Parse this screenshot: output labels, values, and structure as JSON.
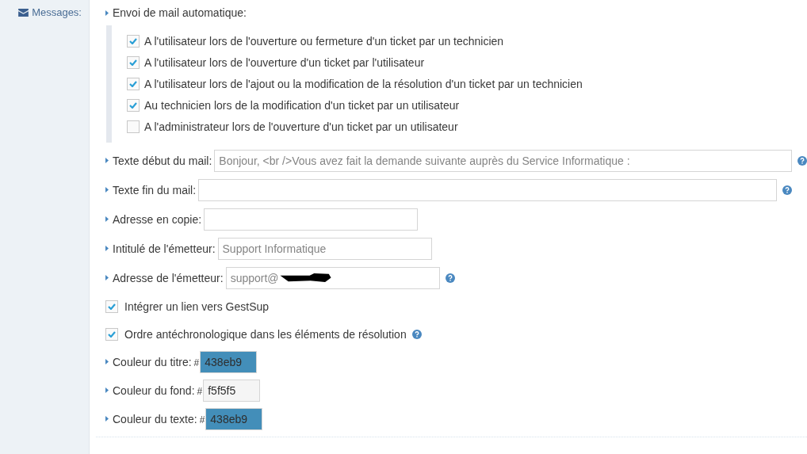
{
  "sidebar": {
    "label": "Messages:"
  },
  "auto_mail": {
    "title": "Envoi de mail automatique:",
    "options": [
      {
        "label": "A l'utilisateur lors de l'ouverture ou fermeture d'un ticket par un technicien",
        "checked": true
      },
      {
        "label": "A l'utilisateur lors de l'ouverture d'un ticket par l'utilisateur",
        "checked": true
      },
      {
        "label": "A l'utilisateur lors de l'ajout ou la modification de la résolution d'un ticket par un technicien",
        "checked": true
      },
      {
        "label": "Au technicien lors de la modification d'un ticket par un utilisateur",
        "checked": true
      },
      {
        "label": "A l'administrateur lors de l'ouverture d'un ticket par un utilisateur",
        "checked": false
      }
    ]
  },
  "settings": [
    {
      "kind": "long_text",
      "label": "Texte début du mail:",
      "value": "Bonjour, <br />Vous avez fait la demande suivante auprès du Service Informatique :",
      "help": true
    },
    {
      "kind": "long_text",
      "label": "Texte fin du mail:",
      "help": true
    },
    {
      "kind": "text",
      "label": "Adresse en copie:",
      "help": false
    },
    {
      "kind": "text",
      "label": "Intitulé de l'émetteur:",
      "value": "Support Informatique",
      "help": false
    },
    {
      "kind": "text",
      "label": "Adresse de l'émetteur:",
      "value": "support@",
      "redacted": true,
      "help": true
    },
    {
      "kind": "check",
      "label": "Intégrer un lien vers GestSup",
      "checked": true,
      "help": false
    },
    {
      "kind": "check",
      "label": "Ordre antéchronologique dans les éléments de résolution",
      "checked": true,
      "help": true
    },
    {
      "kind": "color",
      "label": "Couleur du titre:",
      "hash": "#",
      "value": "438eb9"
    },
    {
      "kind": "color",
      "label": "Couleur du fond:",
      "hash": "#",
      "value": "f5f5f5"
    },
    {
      "kind": "color",
      "label": "Couleur du texte:",
      "hash": "#",
      "value": "438eb9"
    }
  ]
}
